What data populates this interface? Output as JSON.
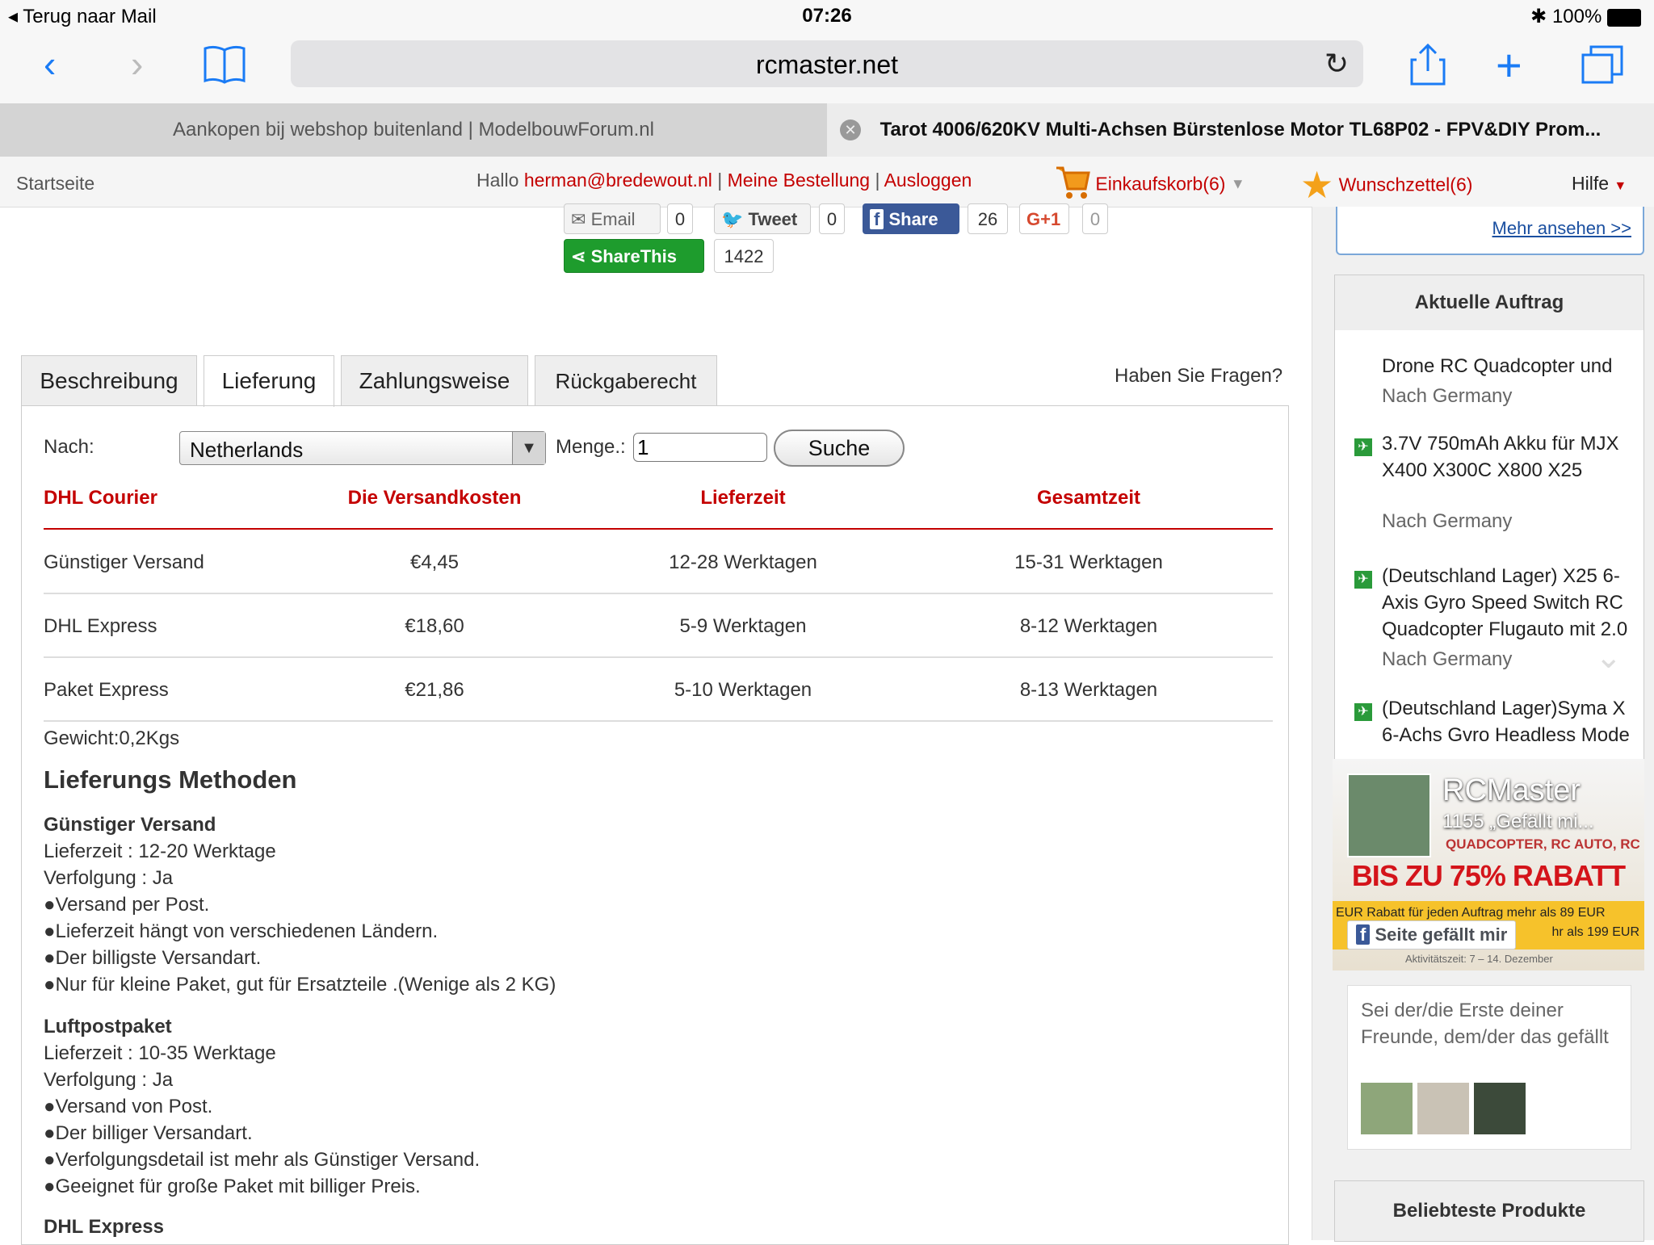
{
  "status": {
    "back_label": "Terug naar Mail",
    "time": "07:26",
    "battery": "100%"
  },
  "browser": {
    "url": "rcmaster.net",
    "tabs": [
      "Aankopen bij webshop buitenland | ModelbouwForum.nl",
      "Tarot 4006/620KV Multi-Achsen Bürstenlose Motor TL68P02 - FPV&DIY Prom..."
    ]
  },
  "site_header": {
    "home": "Startseite",
    "hello": "Hallo",
    "email": "herman@bredewout.nl",
    "orders": "Meine Bestellung",
    "logout": "Ausloggen",
    "cart": "Einkaufskorb(6)",
    "wishlist": "Wunschzettel(6)",
    "help": "Hilfe"
  },
  "share": {
    "email": "Email",
    "email_count": "0",
    "tweet": "Tweet",
    "tweet_count": "0",
    "fb": "Share",
    "fb_count": "26",
    "gplus": "G+1",
    "gplus_count": "0",
    "sharethis": "ShareThis",
    "sharethis_count": "1422"
  },
  "product_tabs": [
    "Beschreibung",
    "Lieferung",
    "Zahlungsweise",
    "Rückgaberecht"
  ],
  "questions": "Haben Sie Fragen?",
  "shipping_form": {
    "to_label": "Nach:",
    "country": "Netherlands",
    "qty_label": "Menge.:",
    "qty": "1",
    "search": "Suche"
  },
  "shipping_table": {
    "headers": [
      "DHL Courier",
      "Die Versandkosten",
      "Lieferzeit",
      "Gesamtzeit"
    ],
    "rows": [
      [
        "Günstiger Versand",
        "€4,45",
        "12-28 Werktagen",
        "15-31 Werktagen"
      ],
      [
        "DHL Express",
        "€18,60",
        "5-9 Werktagen",
        "8-12 Werktagen"
      ],
      [
        "Paket Express",
        "€21,86",
        "5-10 Werktagen",
        "8-13 Werktagen"
      ]
    ]
  },
  "weight": "Gewicht:0,2Kgs",
  "methods": {
    "title": "Lieferungs Methoden",
    "m1": {
      "name": "Günstiger Versand",
      "lines": [
        "Lieferzeit : 12-20 Werktage",
        "Verfolgung : Ja",
        "●Versand per Post.",
        "●Lieferzeit hängt von verschiedenen Ländern.",
        "●Der billigste Versandart.",
        "●Nur für kleine Paket, gut für Ersatzteile .(Wenige als 2 KG)"
      ]
    },
    "m2": {
      "name": "Luftpostpaket",
      "lines": [
        "Lieferzeit : 10-35 Werktage",
        "Verfolgung : Ja",
        "●Versand von Post.",
        "●Der billiger Versandart.",
        "●Verfolgungsdetail ist mehr als Günstiger Versand.",
        "●Geeignet für große Paket mit billiger Preis."
      ]
    },
    "m3": {
      "name": "DHL Express"
    }
  },
  "sidebar": {
    "more": "Mehr ansehen >>",
    "orders_title": "Aktuelle Auftrag",
    "orders": [
      {
        "lines": [
          "Drone RC Quadcopter und"
        ],
        "dest": "Nach Germany"
      },
      {
        "lines": [
          "3.7V 750mAh Akku für MJX",
          "X400 X300C X800 X25"
        ],
        "dest": "Nach Germany"
      },
      {
        "lines": [
          "(Deutschland Lager) X25 6-",
          "Axis Gyro Speed Switch RC",
          "Quadcopter Flugauto mit 2.0"
        ],
        "dest": "Nach Germany"
      },
      {
        "lines": [
          "(Deutschland Lager)Syma X",
          "6-Achs Gvro Headless Mode"
        ],
        "dest": ""
      }
    ],
    "fb_page": "RCMaster",
    "fb_likes": "1155 „Gefällt mi...",
    "banner_line": "QUADCOPTER, RC AUTO, RC",
    "banner_big": "BIS ZU 75% RABATT",
    "banner_small1": "EUR Rabatt für jeden Auftrag mehr als 89 EUR",
    "banner_small2": "hr als 199 EUR",
    "banner_date": "Aktivitätszeit: 7 – 14. Dezember",
    "fb_like_btn": "Seite gefällt mir",
    "fb_friends": "Sei der/die Erste deiner Freunde, dem/der das gefällt",
    "popular_title": "Beliebteste Produkte"
  },
  "colors": {
    "accent_red": "#c40000",
    "ios_blue": "#1a7bf5",
    "fb_blue": "#3b5998",
    "share_green": "#1e9c2d"
  }
}
